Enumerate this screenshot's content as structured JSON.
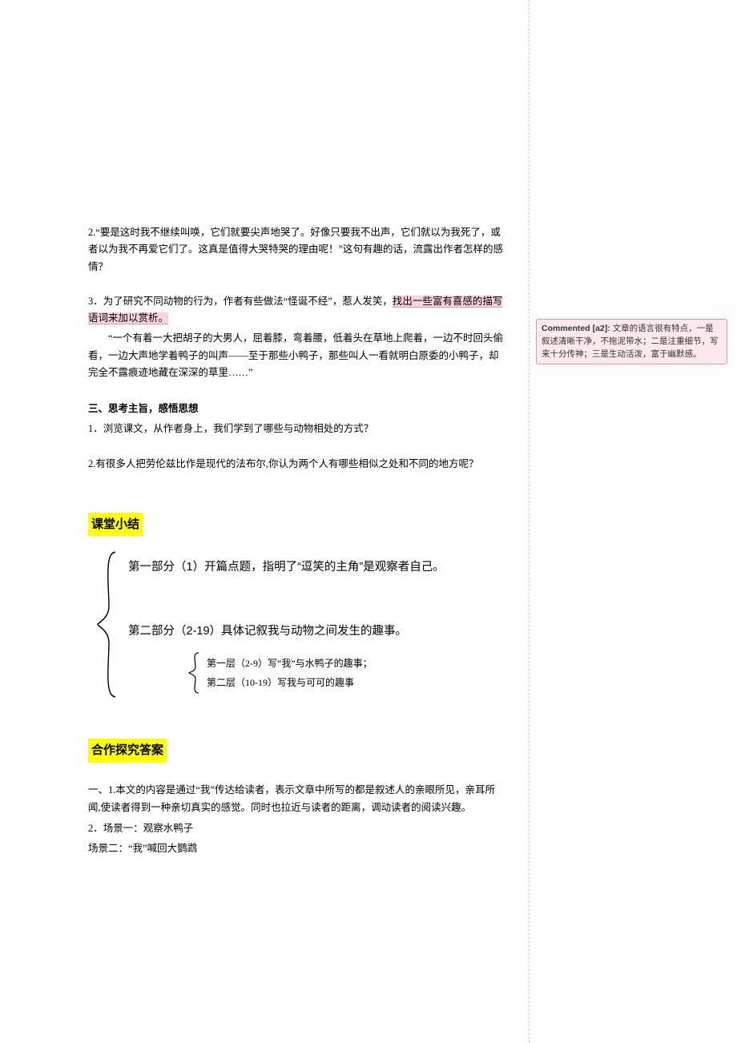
{
  "q2": "2.“要是这时我不继续叫唤，它们就要尖声地哭了。好像只要我不出声，它们就以为我死了，或者以为我不再爱它们了。这真是值得大哭特哭的理由呢！”这句有趣的话，流露出作者怎样的感情？",
  "q3": {
    "lead": "3．为了研究不同动物的行为，作者有些做法“怪诞不经”，惹人发笑，",
    "hl": "找出一些富有喜感的描写语词来加以赏析。",
    "quote": "“一个有着一大把胡子的大男人，屈着膝，弯着腰，低着头在草地上爬着，一边不时回头偷看，一边大声地学着鸭子的叫声——至于那些小鸭子，那些叫人一看就明白原委的小鸭子，却完全不露痕迹地藏在深深的草里……”"
  },
  "sec3": {
    "title": "三、思考主旨，感悟思想",
    "q1": "1．浏览课文，从作者身上，我们学到了哪些与动物相处的方式？",
    "q2": "2.有很多人把劳伦兹比作是现代的法布尔,你认为两个人有哪些相似之处和不同的地方呢？"
  },
  "summary": {
    "label": "课堂小结",
    "p1": "第一部分（1）开篇点题，指明了“逗笑的主角”是观察者自己。",
    "p2": "第二部分（2-19）具体记叙我与动物之间发生的趣事。",
    "s1": "第一层（2-9）写“我”与水鸭子的趣事；",
    "s2": "第二层（10-19）写我与可可的趣事"
  },
  "answers": {
    "label": "合作探究答案",
    "a1": "一、1.本文的内容是通过“我”传达给读者，表示文章中所写的都是叙述人的亲眼所见，亲耳所闻,使读者得到一种亲切真实的感觉。同时也拉近与读者的距离，调动读者的阅读兴趣。",
    "a2a": "2．场景一：观察水鸭子",
    "a2b": "场景二：“我”喊回大鹦鹉"
  },
  "comment": {
    "head": "Commented [a2]:",
    "body": " 文章的语言很有特点，一是叙述清晰干净，不拖泥带水；二是注重细节，写来十分传神；三是生动活泼，富于幽默感。"
  }
}
